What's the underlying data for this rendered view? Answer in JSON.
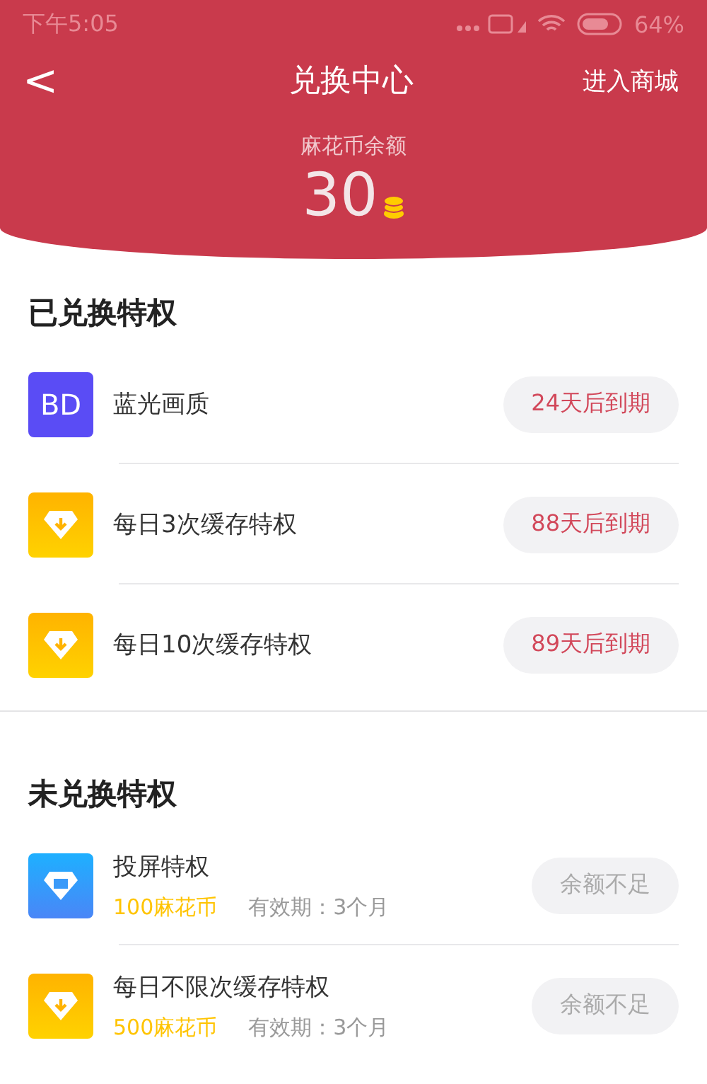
{
  "status_bar": {
    "time": "下午5:05",
    "battery": "64%"
  },
  "nav": {
    "back": "<",
    "title": "兑换中心",
    "action": "进入商城"
  },
  "balance": {
    "label": "麻花币余额",
    "amount": "30"
  },
  "redeemed": {
    "title": "已兑换特权",
    "items": [
      {
        "kind": "bd",
        "icon_text": "BD",
        "name": "蓝光画质",
        "status": "24天后到期"
      },
      {
        "kind": "download",
        "name": "每日3次缓存特权",
        "status": "88天后到期"
      },
      {
        "kind": "download",
        "name": "每日10次缓存特权",
        "status": "89天后到期"
      }
    ]
  },
  "unredeemed": {
    "title": "未兑换特权",
    "items": [
      {
        "kind": "screen",
        "name": "投屏特权",
        "price": "100麻花币",
        "validity": "有效期：3个月",
        "button": "余额不足",
        "disabled": true
      },
      {
        "kind": "download",
        "name": "每日不限次缓存特权",
        "price": "500麻花币",
        "validity": "有效期：3个月",
        "button": "余额不足",
        "disabled": true
      }
    ]
  }
}
